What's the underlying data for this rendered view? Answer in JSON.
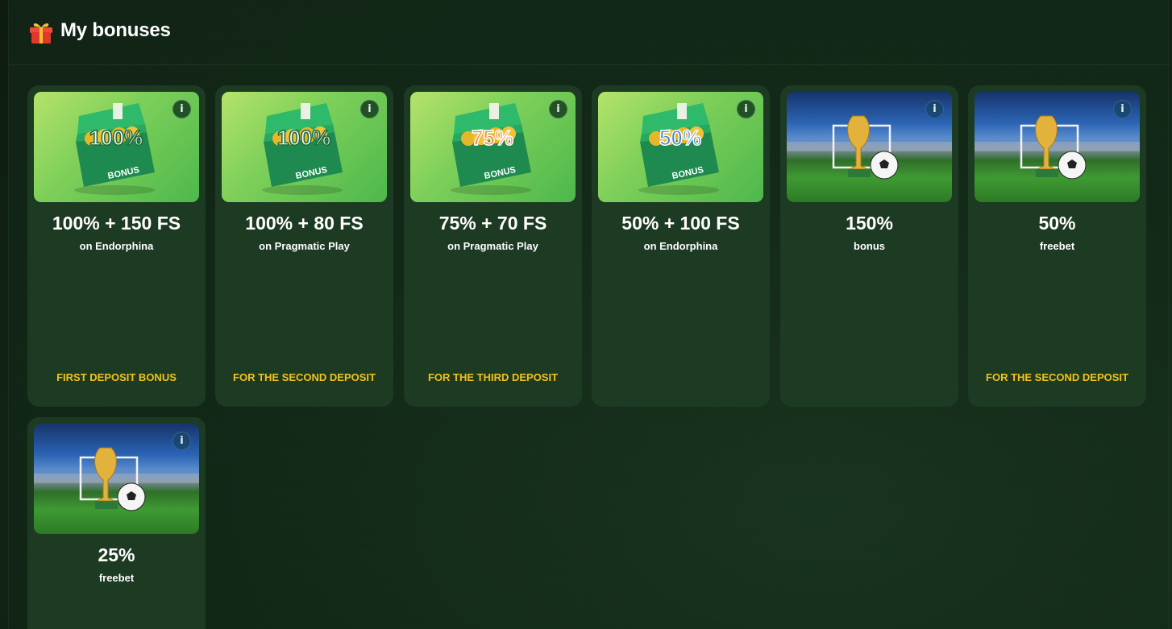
{
  "header": {
    "title": "My bonuses",
    "icon": "gift-icon"
  },
  "cards": [
    {
      "image": "bonus-chest",
      "badge_text": "100%",
      "badge_color": "#f4f4f4",
      "amount": "100% + 150 FS",
      "subtitle": "on Endorphina",
      "tag": "FIRST DEPOSIT BONUS"
    },
    {
      "image": "bonus-chest",
      "badge_text": "100%",
      "badge_color": "#f4f4f4",
      "amount": "100% + 80 FS",
      "subtitle": "on Pragmatic Play",
      "tag": "FOR THE SECOND DEPOSIT"
    },
    {
      "image": "bonus-chest",
      "badge_text": "75%",
      "badge_color": "#f08a3a",
      "amount": "75% + 70 FS",
      "subtitle": "on Pragmatic Play",
      "tag": "FOR THE THIRD DEPOSIT"
    },
    {
      "image": "bonus-chest",
      "badge_text": "50%",
      "badge_color": "#3d7fe0",
      "amount": "50% + 100 FS",
      "subtitle": "on Endorphina",
      "tag": ""
    },
    {
      "image": "football-trophy",
      "amount": "150%",
      "subtitle": "bonus",
      "tag": ""
    },
    {
      "image": "football-trophy",
      "amount": "50%",
      "subtitle": "freebet",
      "tag": "FOR THE SECOND DEPOSIT"
    },
    {
      "image": "football-trophy",
      "amount": "25%",
      "subtitle": "freebet",
      "tag": ""
    }
  ],
  "info_icon_label": "i",
  "colors": {
    "accent_tag": "#f2c21b",
    "card_bg": "#1d3a23",
    "page_bg": "#0f1f13"
  }
}
